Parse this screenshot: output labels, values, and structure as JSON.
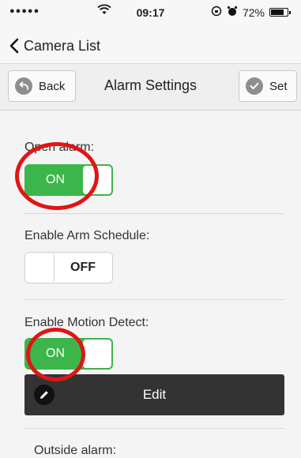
{
  "status_bar": {
    "signal": "●●●●●",
    "time": "09:17",
    "battery_percent": "72%",
    "icons": [
      "wifi-icon",
      "lock-rotation-icon",
      "alarm-clock-icon",
      "battery-icon"
    ]
  },
  "nav": {
    "back_label": "Camera List"
  },
  "toolbar": {
    "back_label": "Back",
    "title": "Alarm Settings",
    "set_label": "Set"
  },
  "settings": {
    "open_alarm": {
      "label": "Open alarm:",
      "state": "ON"
    },
    "arm_schedule": {
      "label": "Enable Arm Schedule:",
      "state": "OFF"
    },
    "motion_detect": {
      "label": "Enable Motion Detect:",
      "state": "ON"
    },
    "edit_label": "Edit",
    "outside_alarm": {
      "label": "Outside alarm:"
    }
  },
  "colors": {
    "toggle_on": "#3cb54a",
    "annotation_ring": "#e01515",
    "edit_bar": "#333333"
  }
}
